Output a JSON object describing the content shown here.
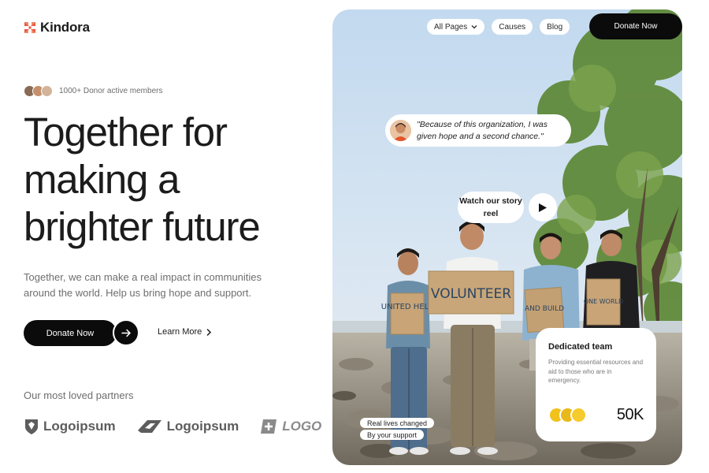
{
  "brand": {
    "name": "Kindora",
    "accent": "#e8573f"
  },
  "members": {
    "text": "1000+ Donor active members"
  },
  "hero": {
    "title_lines": [
      "Together for",
      "making a",
      "brighter future"
    ],
    "description": "Together, we can make a real impact in communities around the world. Help us bring hope and support.",
    "donate_label": "Donate Now",
    "learn_more_label": "Learn More"
  },
  "partners": {
    "title": "Our most loved partners",
    "logos": [
      "Logoipsum",
      "Logoipsum",
      "LOGOIP"
    ]
  },
  "nav": {
    "all_pages": "All Pages",
    "causes": "Causes",
    "blog": "Blog",
    "donate_label": "Donate Now"
  },
  "testimonial": {
    "quote": "\"Because of this organization, I was given hope and a second chance.\""
  },
  "story": {
    "label": "Watch our story reel"
  },
  "tags": {
    "line1": "Real lives changed",
    "line2": "By your support"
  },
  "team_card": {
    "title": "Dedicated team",
    "description": "Providing essential resources and aid to those who are in emergency.",
    "stat": "50K"
  },
  "photo_signs": [
    "VOLUNTEER",
    "UNITED HELP",
    "AND BUILD",
    "ONE WORLD"
  ],
  "icons": {
    "logo": "flower-logo-icon",
    "arrow": "arrow-right-icon",
    "chevron": "chevron-right-icon",
    "dropdown": "chevron-down-icon",
    "play": "play-icon"
  }
}
